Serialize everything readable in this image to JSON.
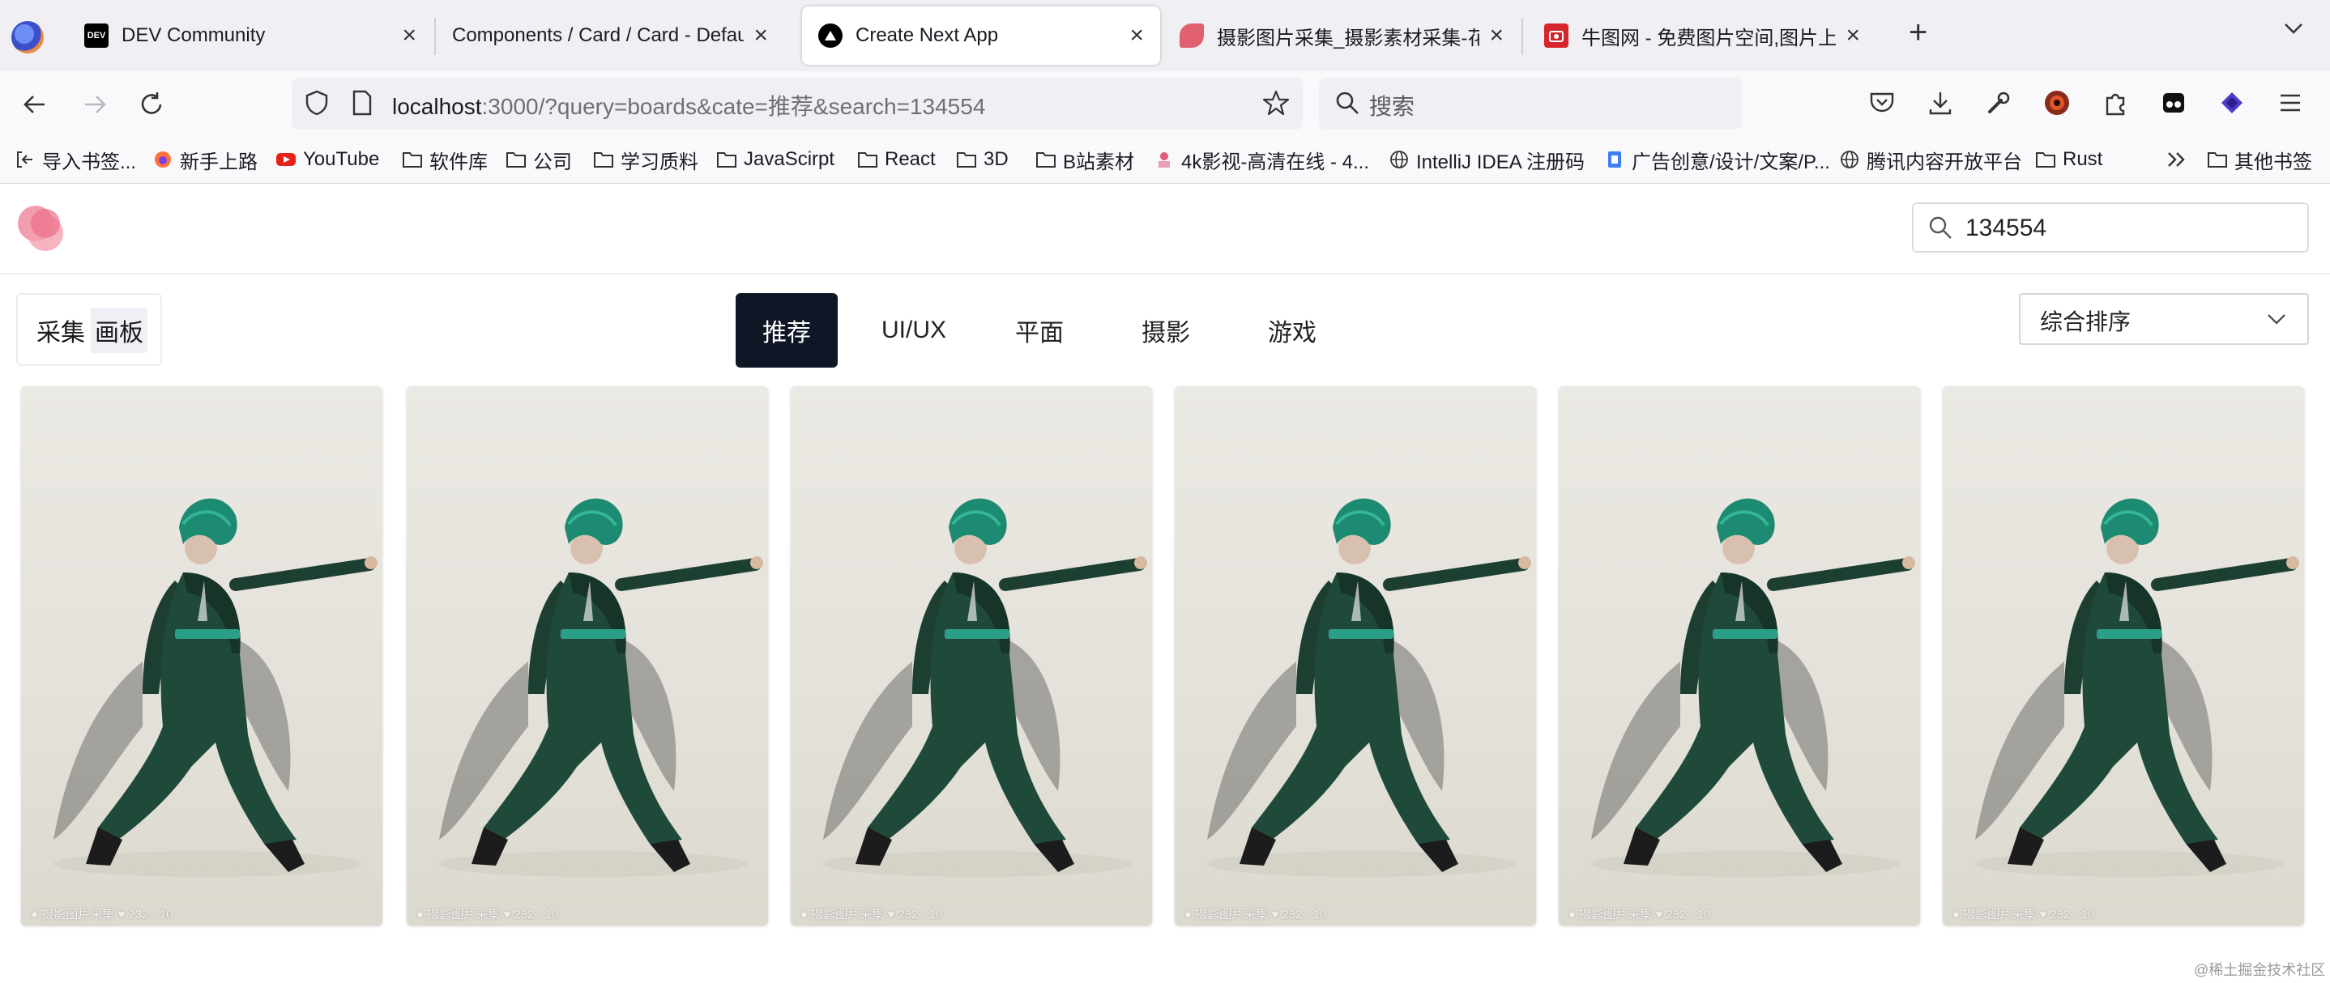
{
  "browser": {
    "tabs": [
      {
        "title": "DEV Community",
        "favicon": "dev-logo",
        "active": false
      },
      {
        "title": "Components / Card / Card - Default",
        "favicon": "none",
        "active": false
      },
      {
        "title": "Create Next App",
        "favicon": "nextjs-logo",
        "active": true
      },
      {
        "title": "摄影图片采集_摄影素材采集-花瓣",
        "favicon": "huaban-logo",
        "active": false
      },
      {
        "title": "牛图网 - 免费图片空间,图片上传,免",
        "favicon": "niutu-logo",
        "active": false
      }
    ],
    "url": {
      "host": "localhost",
      "rest": ":3000/?query=boards&cate=推荐&search=134554"
    },
    "search_placeholder": "搜索",
    "bookmarks": [
      {
        "label": "导入书签...",
        "icon": "import-icon"
      },
      {
        "label": "新手上路",
        "icon": "firefox-icon"
      },
      {
        "label": "YouTube",
        "icon": "youtube-icon"
      },
      {
        "label": "软件库",
        "icon": "folder-icon"
      },
      {
        "label": "公司",
        "icon": "folder-icon"
      },
      {
        "label": "学习质料",
        "icon": "folder-icon"
      },
      {
        "label": "JavaScirpt",
        "icon": "folder-icon"
      },
      {
        "label": "React",
        "icon": "folder-icon"
      },
      {
        "label": "3D",
        "icon": "folder-icon"
      },
      {
        "label": "B站素材",
        "icon": "folder-icon"
      },
      {
        "label": "4k影视-高清在线 - 4...",
        "icon": "site-icon"
      },
      {
        "label": "IntelliJ IDEA 注册码",
        "icon": "globe-icon"
      },
      {
        "label": "广告创意/设计/文案/P...",
        "icon": "doc-icon"
      },
      {
        "label": "腾讯内容开放平台",
        "icon": "globe-icon"
      },
      {
        "label": "Rust",
        "icon": "folder-icon"
      },
      {
        "label": "其他书签",
        "icon": "folder-icon"
      }
    ]
  },
  "page": {
    "search_value": "134554",
    "view_toggle": [
      {
        "label": "采集",
        "selected": false
      },
      {
        "label": "画板",
        "selected": true
      }
    ],
    "categories": [
      {
        "label": "推荐",
        "active": true
      },
      {
        "label": "UI/UX",
        "active": false
      },
      {
        "label": "平面",
        "active": false
      },
      {
        "label": "摄影",
        "active": false
      },
      {
        "label": "游戏",
        "active": false
      }
    ],
    "sort_value": "综合排序",
    "cards": [
      {
        "caption": "● 摄影图片采集 ♥ 232 · 10"
      },
      {
        "caption": "● 摄影图片采集 ♥ 232 · 10"
      },
      {
        "caption": "● 摄影图片采集 ♥ 232 · 10"
      },
      {
        "caption": "● 摄影图片采集 ♥ 232 · 10"
      },
      {
        "caption": "● 摄影图片采集 ♥ 232 · 10"
      },
      {
        "caption": "● 摄影图片采集 ♥ 232 · 10"
      }
    ],
    "watermark": "@稀土掘金技术社区"
  },
  "colors": {
    "accent_dark": "#0f1626",
    "logo_pink": "#f08ca0",
    "dress_green": "#1f4a3a"
  }
}
